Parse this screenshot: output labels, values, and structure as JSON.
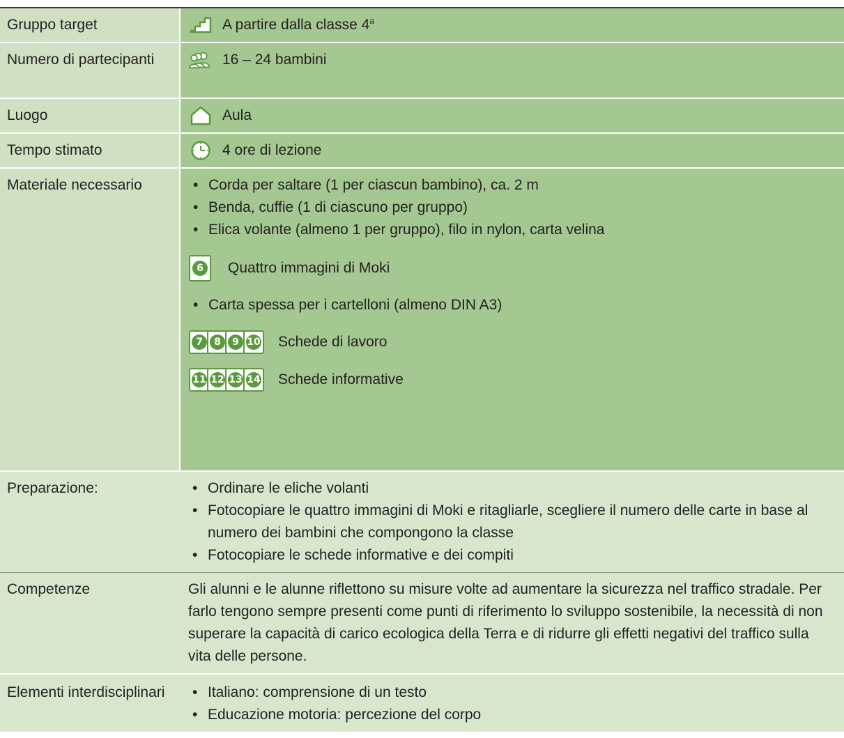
{
  "rows": {
    "target": {
      "label": "Gruppo target",
      "value_main": "A partire dalla classe 4",
      "value_sup": "a"
    },
    "participants": {
      "label": "Numero di partecipanti",
      "value": "16 – 24 bambini"
    },
    "place": {
      "label": "Luogo",
      "value": "Aula"
    },
    "time": {
      "label": "Tempo stimato",
      "value": "4 ore di lezione"
    },
    "material": {
      "label": "Materiale necessario",
      "bullets": [
        "Corda per saltare (1 per ciascun bambino), ca. 2 m",
        "Benda, cuffie (1 di ciascuno per gruppo)",
        "Elica volante (almeno 1 per gruppo), filo in nylon, carta velina"
      ],
      "doc_single": {
        "number": "6",
        "text": "Quattro immagini di Moki"
      },
      "bullet_extra": "Carta spessa per i cartelloni (almeno DIN A3)",
      "doc_work": {
        "numbers": [
          "7",
          "8",
          "9",
          "10"
        ],
        "text": "Schede di lavoro"
      },
      "doc_info": {
        "numbers": [
          "11",
          "12",
          "13",
          "14"
        ],
        "text": "Schede informative"
      }
    },
    "preparation": {
      "label": "Preparazione:",
      "bullets": [
        "Ordinare le eliche volanti",
        "Fotocopiare le quattro immagini di Moki e ritagliarle, scegliere il numero delle carte in base al numero dei bambini che compongono la classe",
        "Fotocopiare le schede informative e dei compiti"
      ]
    },
    "skills": {
      "label": "Competenze",
      "text": "Gli alunni e le alunne riflettono su misure volte ad aumentare la sicurezza nel traffico stradale. Per farlo tengono sempre presenti come punti di riferimento lo sviluppo sostenibile, la necessità di non superare la capacità di carico ecologica della Terra e di ridurre gli effetti negativi del traffico sulla vita delle persone."
    },
    "interdisciplinary": {
      "label": "Elementi interdisciplinari",
      "bullets": [
        "Italiano: comprensione di un testo",
        "Educazione motoria: percezione del corpo"
      ]
    }
  },
  "icons": {
    "target": "stairs-icon",
    "participants": "group-icon",
    "place": "house-icon",
    "time": "clock-icon"
  },
  "colors": {
    "label_bg": "#cfe0c3",
    "value_bg": "#a5c791",
    "accent": "#5a9a3c"
  }
}
